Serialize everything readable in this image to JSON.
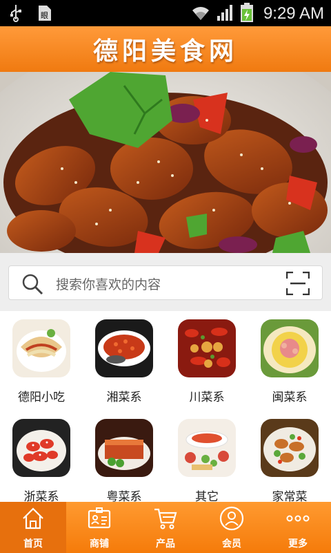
{
  "status_bar": {
    "time": "9:29 AM",
    "icons": [
      "usb-icon",
      "sim-icon",
      "wifi-icon",
      "signal-icon",
      "battery-icon"
    ]
  },
  "header": {
    "title": "德阳美食网"
  },
  "banner": {
    "slides": 5,
    "active_slide": 2
  },
  "search": {
    "placeholder": "搜索你喜欢的内容"
  },
  "categories": [
    {
      "label": "德阳小吃"
    },
    {
      "label": "湘菜系"
    },
    {
      "label": "川菜系"
    },
    {
      "label": "闽菜系"
    },
    {
      "label": "浙菜系"
    },
    {
      "label": "粤菜系"
    },
    {
      "label": "其它"
    },
    {
      "label": "家常菜"
    }
  ],
  "bottom_nav": {
    "items": [
      {
        "label": "首页",
        "icon": "home-icon"
      },
      {
        "label": "商铺",
        "icon": "shop-card-icon"
      },
      {
        "label": "产品",
        "icon": "cart-icon"
      },
      {
        "label": "会员",
        "icon": "member-icon"
      },
      {
        "label": "更多",
        "icon": "more-icon"
      }
    ],
    "active_index": 0
  },
  "colors": {
    "accent": "#f58a1f",
    "status_bar": "#000000"
  }
}
